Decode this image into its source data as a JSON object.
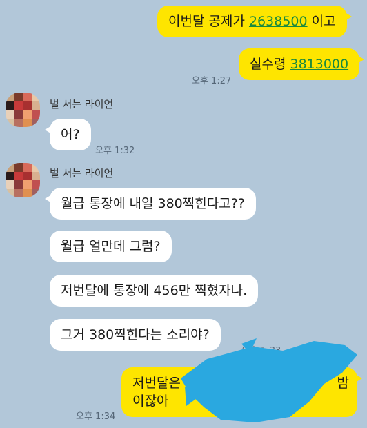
{
  "messages": {
    "m1": {
      "prefix": "이번달 공제가 ",
      "amount": "2638500",
      "suffix": " 이고"
    },
    "m2": {
      "prefix": "실수령 ",
      "amount": "3813000"
    },
    "m2_time": "오후 1:27",
    "sender_name": "벌 서는 라이언",
    "m3": "어?",
    "m3_time": "오후 1:32",
    "m4": "월급 통장에 내일 380찍힌다고??",
    "m5": "월급 얼만데 그럼?",
    "m6": "저번달에 통장에 456만 찍혔자나.",
    "m7": "그거 380찍힌다는 소리야?",
    "m7_time": "오후 1:33",
    "m8_line1_start": "저번달은",
    "m8_line1_end": "밤",
    "m8_line2": "이잖아",
    "m8_time": "오후 1:34"
  },
  "avatar_colors": [
    "#c8a07a",
    "#7a3a2a",
    "#d86a5a",
    "#e8c8a8",
    "#2a1a1a",
    "#c83a3a",
    "#a83030",
    "#d8b090",
    "#e8d0b8",
    "#8a3a3a",
    "#f0a070",
    "#c05050",
    "#d8c0a0",
    "#b87060",
    "#e09050",
    "#a06060"
  ],
  "colors": {
    "background": "#b2c7d9",
    "my_bubble": "#fee500",
    "their_bubble": "#ffffff",
    "link": "#1b8a3e",
    "censor": "#2aa8e0"
  }
}
